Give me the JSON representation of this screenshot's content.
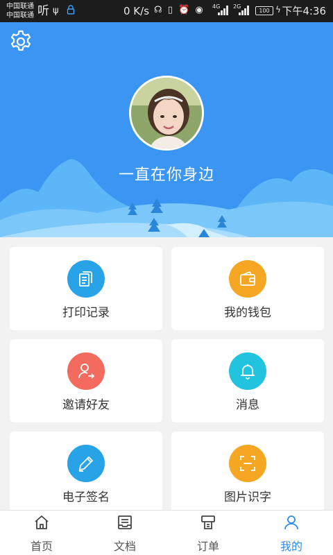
{
  "status_bar": {
    "carrier_1": "中国联通",
    "carrier_2": "中国联通",
    "ting": "听",
    "speed": "0 K/s",
    "net_1": "4G",
    "net_2": "2G",
    "battery": "100",
    "time": "下午4:36"
  },
  "profile": {
    "nickname": "一直在你身边"
  },
  "menu": [
    {
      "label": "打印记录",
      "icon": "print-record-icon",
      "color": "#29a3e8"
    },
    {
      "label": "我的钱包",
      "icon": "wallet-icon",
      "color": "#f5a623"
    },
    {
      "label": "邀请好友",
      "icon": "invite-friend-icon",
      "color": "#f26b5e"
    },
    {
      "label": "消息",
      "icon": "bell-icon",
      "color": "#22c3df"
    },
    {
      "label": "电子签名",
      "icon": "pen-icon",
      "color": "#29a3e8"
    },
    {
      "label": "图片识字",
      "icon": "scan-icon",
      "color": "#f5a623"
    }
  ],
  "tabs": [
    {
      "label": "首页",
      "icon": "home-icon",
      "active": false
    },
    {
      "label": "文档",
      "icon": "document-icon",
      "active": false
    },
    {
      "label": "订单",
      "icon": "order-icon",
      "active": false
    },
    {
      "label": "我的",
      "icon": "profile-icon",
      "active": true
    }
  ],
  "colors": {
    "header_bg": "#3a96f2",
    "active_tab": "#2d8cf0"
  }
}
